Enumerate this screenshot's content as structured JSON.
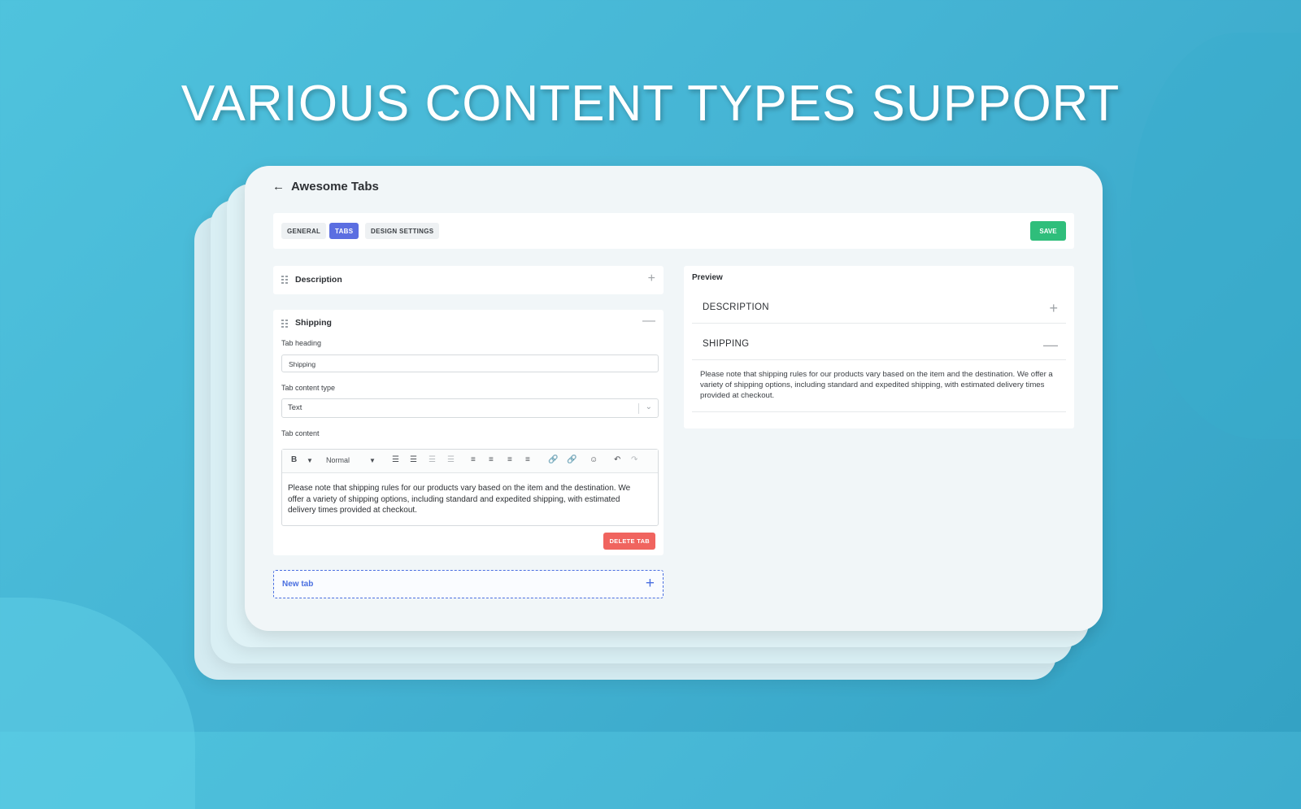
{
  "headline": "VARIOUS CONTENT TYPES SUPPORT",
  "app": {
    "title": "Awesome Tabs"
  },
  "toolbar": {
    "tabs": [
      "GENERAL",
      "TABS",
      "DESIGN SETTINGS"
    ],
    "active_tab": "TABS",
    "save_label": "SAVE"
  },
  "tabs_editor": {
    "description": {
      "title": "Description",
      "toggle": "+"
    },
    "shipping": {
      "title": "Shipping",
      "toggle": "—",
      "heading_label": "Tab heading",
      "heading_value": "Shipping",
      "content_type_label": "Tab content type",
      "content_type_value": "Text",
      "content_label": "Tab content",
      "format_value": "Normal",
      "content_text": "Please note that shipping rules for our products vary based on the item and the destination. We offer a variety of shipping options, including standard and expedited shipping, with estimated delivery times provided at checkout.",
      "delete_label": "DELETE TAB"
    },
    "new_tab": {
      "label": "New tab",
      "icon": "+"
    }
  },
  "preview": {
    "label": "Preview",
    "items": [
      {
        "title": "DESCRIPTION",
        "toggle": "+"
      },
      {
        "title": "SHIPPING",
        "toggle": "—"
      }
    ],
    "shipping_text": "Please note that shipping rules for our products vary based on the item and the destination. We offer a variety of shipping options, including standard and expedited shipping, with estimated delivery times provided at checkout."
  },
  "colors": {
    "accent": "#5b6ee1",
    "save": "#2fbe7b",
    "delete": "#f0645f",
    "new_tab": "#4a6fe0"
  }
}
